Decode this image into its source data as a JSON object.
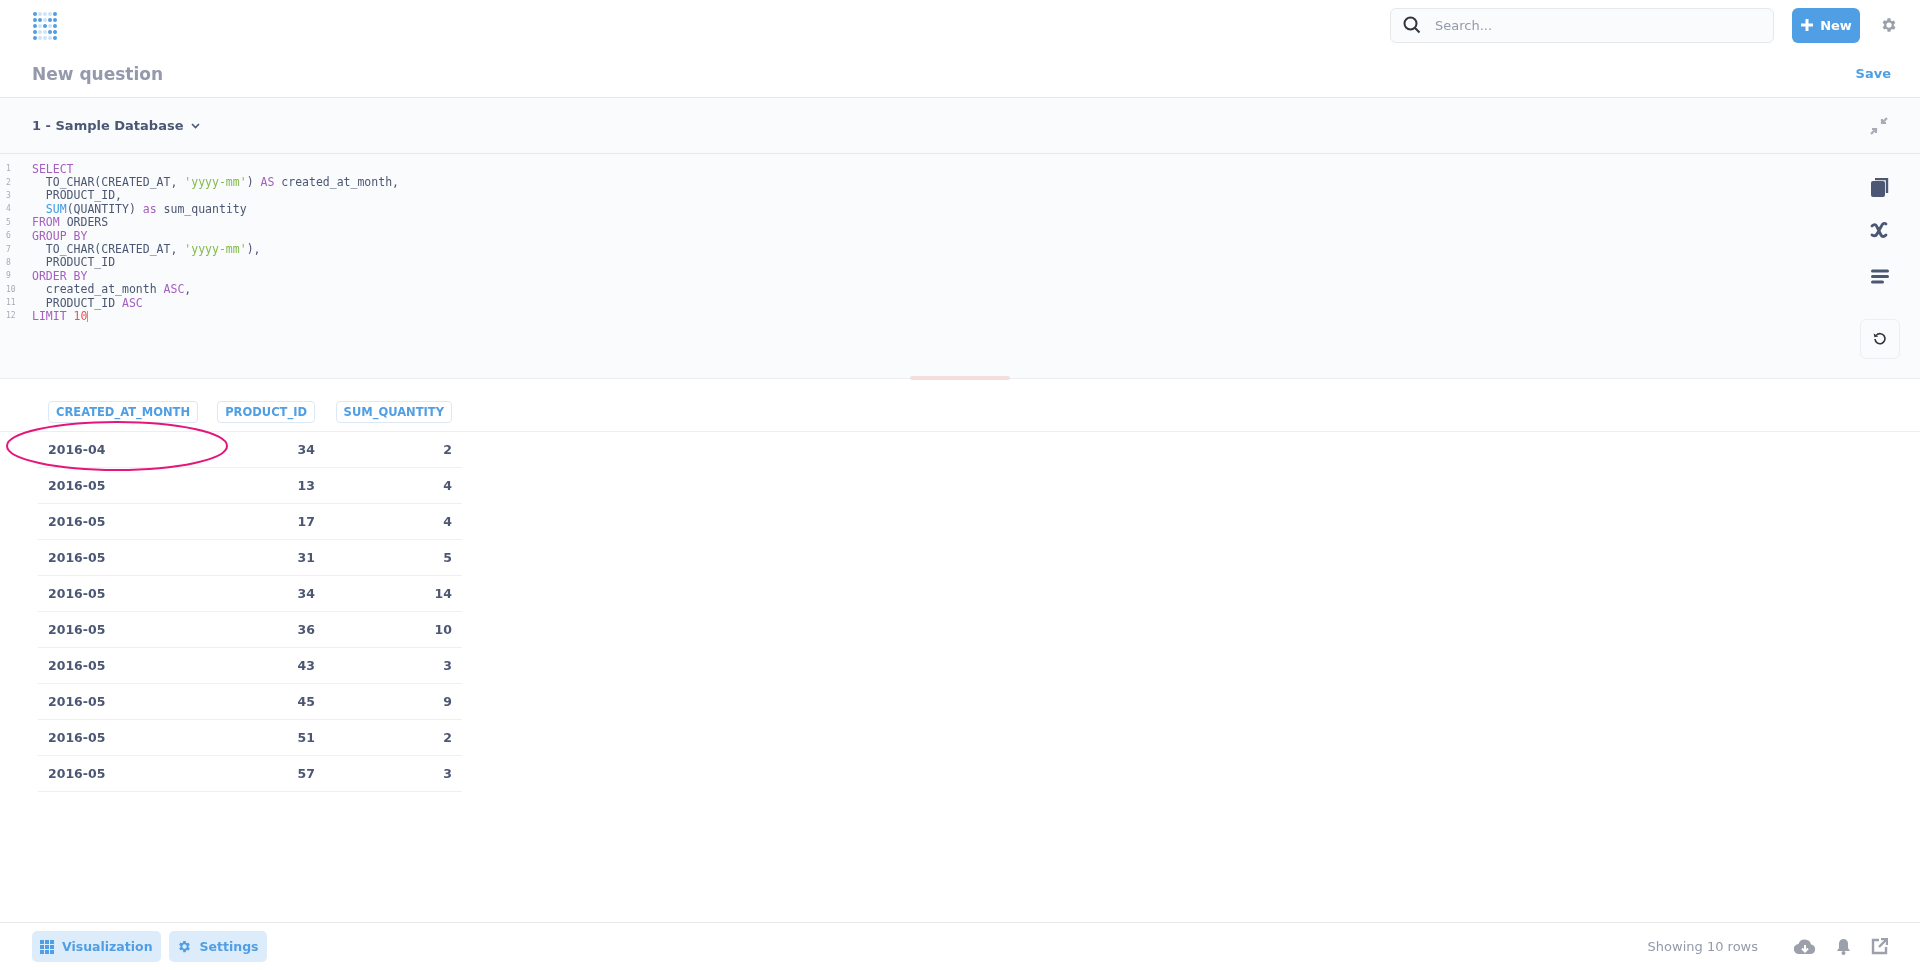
{
  "top_bar": {
    "search": {
      "placeholder": "Search..."
    },
    "new_button": "New"
  },
  "header": {
    "title": "New question",
    "save": "Save"
  },
  "database_bar": {
    "database": "1 - Sample Database"
  },
  "editor": {
    "lines": [
      {
        "number": "1",
        "indented": false,
        "tokens": [
          {
            "text": "SELECT",
            "kind": "keyword"
          }
        ]
      },
      {
        "number": "2",
        "indented": true,
        "tokens": [
          {
            "text": "TO_CHAR(CREATED_AT, ",
            "kind": "plain"
          },
          {
            "text": "'yyyy-mm'",
            "kind": "string"
          },
          {
            "text": ") ",
            "kind": "plain"
          },
          {
            "text": "AS",
            "kind": "keyword"
          },
          {
            "text": " created_at_month,",
            "kind": "plain"
          }
        ]
      },
      {
        "number": "3",
        "indented": true,
        "tokens": [
          {
            "text": "PRODUCT_ID,",
            "kind": "plain"
          }
        ]
      },
      {
        "number": "4",
        "indented": true,
        "tokens": [
          {
            "text": "SUM",
            "kind": "function"
          },
          {
            "text": "(QUANTITY) ",
            "kind": "plain"
          },
          {
            "text": "as",
            "kind": "keyword"
          },
          {
            "text": " sum_quantity",
            "kind": "plain"
          }
        ]
      },
      {
        "number": "5",
        "indented": false,
        "tokens": [
          {
            "text": "FROM",
            "kind": "keyword"
          },
          {
            "text": " ORDERS",
            "kind": "plain"
          }
        ]
      },
      {
        "number": "6",
        "indented": false,
        "tokens": [
          {
            "text": "GROUP BY",
            "kind": "keyword"
          }
        ]
      },
      {
        "number": "7",
        "indented": true,
        "tokens": [
          {
            "text": "TO_CHAR(CREATED_AT, ",
            "kind": "plain"
          },
          {
            "text": "'yyyy-mm'",
            "kind": "string"
          },
          {
            "text": "),",
            "kind": "plain"
          }
        ]
      },
      {
        "number": "8",
        "indented": true,
        "tokens": [
          {
            "text": "PRODUCT_ID",
            "kind": "plain"
          }
        ]
      },
      {
        "number": "9",
        "indented": false,
        "tokens": [
          {
            "text": "ORDER BY",
            "kind": "keyword"
          }
        ]
      },
      {
        "number": "10",
        "indented": true,
        "tokens": [
          {
            "text": "created_at_month ",
            "kind": "plain"
          },
          {
            "text": "ASC",
            "kind": "keyword"
          },
          {
            "text": ",",
            "kind": "plain"
          }
        ]
      },
      {
        "number": "11",
        "indented": true,
        "tokens": [
          {
            "text": "PRODUCT_ID ",
            "kind": "plain"
          },
          {
            "text": "ASC",
            "kind": "keyword"
          }
        ]
      },
      {
        "number": "12",
        "indented": false,
        "tokens": [
          {
            "text": "LIMIT",
            "kind": "keyword"
          },
          {
            "text": "10",
            "kind": "number",
            "space_before": true
          }
        ]
      }
    ]
  },
  "table": {
    "columns": [
      {
        "label": "CREATED_AT_MONTH",
        "kind": "text"
      },
      {
        "label": "PRODUCT_ID",
        "kind": "number"
      },
      {
        "label": "SUM_QUANTITY",
        "kind": "number"
      }
    ],
    "rows": [
      [
        "2016-04",
        "34",
        "2"
      ],
      [
        "2016-05",
        "13",
        "4"
      ],
      [
        "2016-05",
        "17",
        "4"
      ],
      [
        "2016-05",
        "31",
        "5"
      ],
      [
        "2016-05",
        "34",
        "14"
      ],
      [
        "2016-05",
        "36",
        "10"
      ],
      [
        "2016-05",
        "43",
        "3"
      ],
      [
        "2016-05",
        "45",
        "9"
      ],
      [
        "2016-05",
        "51",
        "2"
      ],
      [
        "2016-05",
        "57",
        "3"
      ]
    ]
  },
  "footer": {
    "buttons": [
      {
        "label": "Visualization",
        "kind": "grid"
      },
      {
        "label": "Settings",
        "kind": "gear"
      }
    ],
    "row_count": "Showing 10 rows"
  }
}
